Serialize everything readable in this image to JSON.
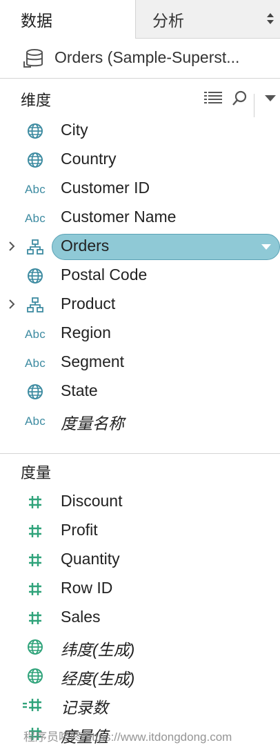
{
  "tabs": {
    "data": "数据",
    "analysis": "分析"
  },
  "datasource": {
    "name": "Orders (Sample-Superst..."
  },
  "dimensions": {
    "title": "维度",
    "items": [
      {
        "type": "geo",
        "label": "City",
        "italic": false,
        "expand": false
      },
      {
        "type": "geo",
        "label": "Country",
        "italic": false,
        "expand": false
      },
      {
        "type": "string",
        "label": "Customer ID",
        "italic": false,
        "expand": false
      },
      {
        "type": "string",
        "label": "Customer Name",
        "italic": false,
        "expand": false
      },
      {
        "type": "hierarchy",
        "label": "Orders",
        "italic": false,
        "expand": true,
        "selected": true
      },
      {
        "type": "geo",
        "label": "Postal Code",
        "italic": false,
        "expand": false
      },
      {
        "type": "hierarchy",
        "label": "Product",
        "italic": false,
        "expand": true
      },
      {
        "type": "string",
        "label": "Region",
        "italic": false,
        "expand": false
      },
      {
        "type": "string",
        "label": "Segment",
        "italic": false,
        "expand": false
      },
      {
        "type": "geo",
        "label": "State",
        "italic": false,
        "expand": false
      },
      {
        "type": "string",
        "label": "度量名称",
        "italic": true,
        "expand": false
      }
    ]
  },
  "measures": {
    "title": "度量",
    "items": [
      {
        "type": "number",
        "label": "Discount",
        "italic": false
      },
      {
        "type": "number",
        "label": "Profit",
        "italic": false
      },
      {
        "type": "number",
        "label": "Quantity",
        "italic": false
      },
      {
        "type": "number",
        "label": "Row ID",
        "italic": false
      },
      {
        "type": "number",
        "label": "Sales",
        "italic": false
      },
      {
        "type": "geo-measure",
        "label": "纬度(生成)",
        "italic": true
      },
      {
        "type": "geo-measure",
        "label": "经度(生成)",
        "italic": true
      },
      {
        "type": "calc-number",
        "label": "记录数",
        "italic": true
      },
      {
        "type": "number",
        "label": "度量值",
        "italic": true
      }
    ]
  },
  "abc_text": "Abc",
  "watermark": "程序员咚咚 https://www.itdongdong.com",
  "icons": {
    "geo": "globe-icon",
    "string": "abc-icon",
    "hierarchy": "hierarchy-icon",
    "number": "hash-icon",
    "calc-number": "calc-hash-icon",
    "sort": "list-view-icon",
    "search": "search-icon",
    "menu": "dropdown-caret-icon"
  },
  "colors": {
    "dimension": "#3d8ba1",
    "measure": "#2fa37a",
    "selected_pill": "#8fc9d6"
  }
}
